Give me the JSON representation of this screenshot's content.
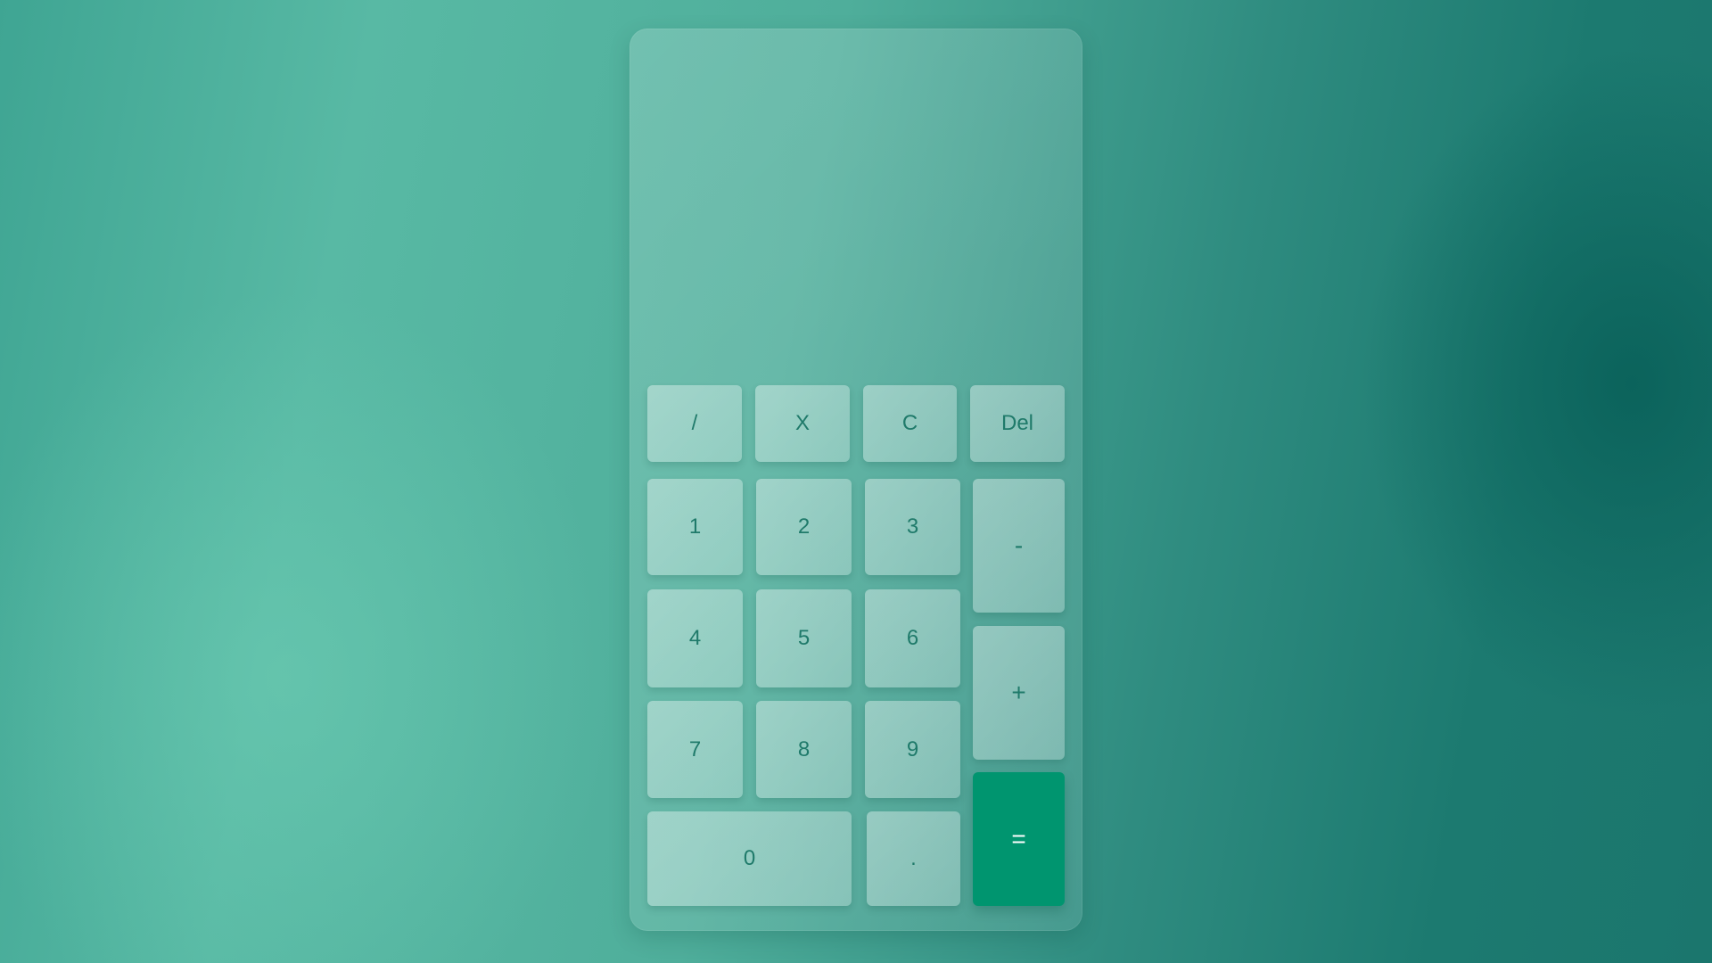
{
  "calculator": {
    "display_value": "",
    "keys": {
      "divide": "/",
      "multiply": "X",
      "clear": "C",
      "delete": "Del",
      "one": "1",
      "two": "2",
      "three": "3",
      "minus": "-",
      "four": "4",
      "five": "5",
      "six": "6",
      "plus": "+",
      "seven": "7",
      "eight": "8",
      "nine": "9",
      "zero": "0",
      "decimal": ".",
      "equals": "="
    },
    "colors": {
      "key_text": "#1f7a6a",
      "equals_bg": "#00956f",
      "equals_text": "#ffffff"
    }
  }
}
